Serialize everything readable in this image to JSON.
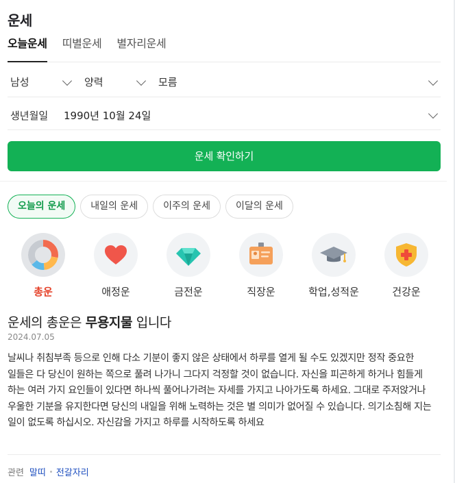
{
  "header": {
    "title": "운세"
  },
  "tabs": [
    {
      "label": "오늘운세"
    },
    {
      "label": "띠별운세"
    },
    {
      "label": "별자리운세"
    }
  ],
  "form": {
    "gender": "남성",
    "calendar": "양력",
    "birth_time": "모름",
    "birth_label": "생년월일",
    "birth_value": "1990년 10월 24일",
    "submit_label": "운세 확인하기"
  },
  "period_chips": [
    {
      "label": "오늘의 운세"
    },
    {
      "label": "내일의 운세"
    },
    {
      "label": "이주의 운세"
    },
    {
      "label": "이달의 운세"
    }
  ],
  "categories": [
    {
      "label": "총운",
      "icon": "pie-chart-icon"
    },
    {
      "label": "애정운",
      "icon": "heart-icon"
    },
    {
      "label": "금전운",
      "icon": "diamond-icon"
    },
    {
      "label": "직장운",
      "icon": "id-badge-icon"
    },
    {
      "label": "학업,성적운",
      "icon": "graduation-cap-icon"
    },
    {
      "label": "건강운",
      "icon": "health-shield-icon"
    }
  ],
  "result": {
    "title_prefix": "운세의 총운은 ",
    "title_highlight": "무용지물",
    "title_suffix": " 입니다",
    "date": "2024.07.05",
    "body": "날씨나 취침부족 등으로 인해 다소 기분이 좋지 않은 상태에서 하루를 열게 될 수도 있겠지만 정작 중요한 일들은 다 당신이 원하는 쪽으로 풀려 나가니 그다지 걱정할 것이 없습니다. 자신을 피곤하게 하거나 힘들게 하는 여러 가지 요인들이 있다면 하나씩 풀어나가려는 자세를 가지고 나아가도록 하세요. 그대로 주저앉거나 우울한 기분을 유지한다면 당신의 내일을 위해 노력하는 것은 별 의미가 없어질 수 있습니다. 의기소침해 지는 일이 없도록 하십시오. 자신감을 가지고 하루를 시작하도록 하세요"
  },
  "related": {
    "label": "관련",
    "links": [
      {
        "label": "말띠"
      },
      {
        "label": "전갈자리"
      }
    ]
  },
  "colors": {
    "accent_green": "#13b155",
    "active_category": "#e5442c",
    "link_blue": "#1d4ebf"
  }
}
